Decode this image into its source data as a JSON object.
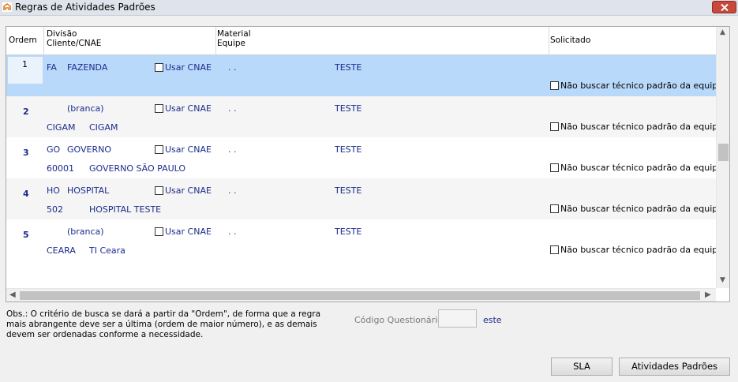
{
  "window": {
    "title": "Regras de Atividades Padrões",
    "close_glyph": "✕"
  },
  "header": {
    "ordem": "Ordem",
    "divisao": "Divisão",
    "cliente_cnae": "Cliente/CNAE",
    "material": "Material",
    "equipe": "Equipe",
    "solicitado": "Solicitado"
  },
  "rows": [
    {
      "ordem": "1",
      "div_code": "FA",
      "div_name": "FAZENDA",
      "usar_cnae": "Usar CNAE",
      "material": ". .",
      "equipe": "TESTE",
      "cliente_code": "",
      "cliente_name": "",
      "nao_buscar": "Não buscar técnico padrão da equipe",
      "selected": true
    },
    {
      "ordem": "2",
      "div_code": "",
      "div_name": "(branca)",
      "usar_cnae": "Usar CNAE",
      "material": ". .",
      "equipe": "TESTE",
      "cliente_code": "CIGAM",
      "cliente_name": "CIGAM",
      "nao_buscar": "Não buscar técnico padrão da equipe",
      "selected": false
    },
    {
      "ordem": "3",
      "div_code": "GO",
      "div_name": "GOVERNO",
      "usar_cnae": "Usar CNAE",
      "material": ". .",
      "equipe": "TESTE",
      "cliente_code": "60001",
      "cliente_name": "GOVERNO SÃO PAULO",
      "nao_buscar": "Não buscar técnico padrão da equipe",
      "selected": false
    },
    {
      "ordem": "4",
      "div_code": "HO",
      "div_name": "HOSPITAL",
      "usar_cnae": "Usar CNAE",
      "material": ". .",
      "equipe": "TESTE",
      "cliente_code": "502",
      "cliente_name": "HOSPITAL TESTE",
      "nao_buscar": "Não buscar técnico padrão da equipe",
      "selected": false
    },
    {
      "ordem": "5",
      "div_code": "",
      "div_name": "(branca)",
      "usar_cnae": "Usar CNAE",
      "material": ". .",
      "equipe": "TESTE",
      "cliente_code": "CEARA",
      "cliente_name": "TI Ceara",
      "nao_buscar": "Não buscar técnico padrão da equipe",
      "selected": false
    }
  ],
  "footer": {
    "obs": "Obs.: O critério de busca se dará a partir da \"Ordem\", de forma que a regra mais abrangente deve ser a última (ordem de maior número), e as demais devem ser ordenadas conforme a necessidade.",
    "codigo_label": "Código Questionário",
    "codigo_value": "",
    "este": "este",
    "sla_button": "SLA",
    "atividades_button": "Atividades Padrões"
  },
  "colors": {
    "selected_row": "#b9d9fb",
    "alt_row": "#f5f5f5",
    "link_text": "#1c2c8c"
  }
}
